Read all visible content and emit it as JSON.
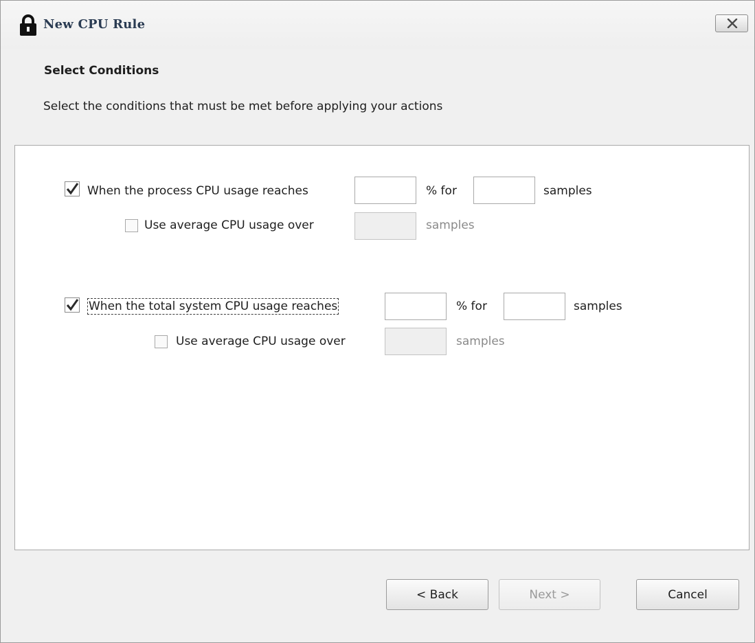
{
  "window": {
    "title": "New CPU Rule",
    "close_label": "close"
  },
  "header": {
    "title": "Select Conditions",
    "description": "Select the conditions that must be met before applying your actions"
  },
  "process_condition": {
    "checked": true,
    "label": "When the process CPU usage reaches",
    "percent_value": "",
    "percent_suffix": "% for",
    "samples_value": "",
    "samples_suffix": "samples",
    "average": {
      "checked": false,
      "label": "Use average CPU usage over",
      "value": "",
      "suffix": "samples"
    }
  },
  "system_condition": {
    "checked": true,
    "label": "When the total system CPU usage reaches",
    "percent_value": "",
    "percent_suffix": "% for",
    "samples_value": "",
    "samples_suffix": "samples",
    "average": {
      "checked": false,
      "label": "Use average CPU usage over",
      "value": "",
      "suffix": "samples"
    }
  },
  "buttons": {
    "back": "< Back",
    "next": "Next >",
    "cancel": "Cancel"
  },
  "icons": {
    "title": "lock-icon",
    "close": "close-icon",
    "check": "checkmark-icon"
  }
}
